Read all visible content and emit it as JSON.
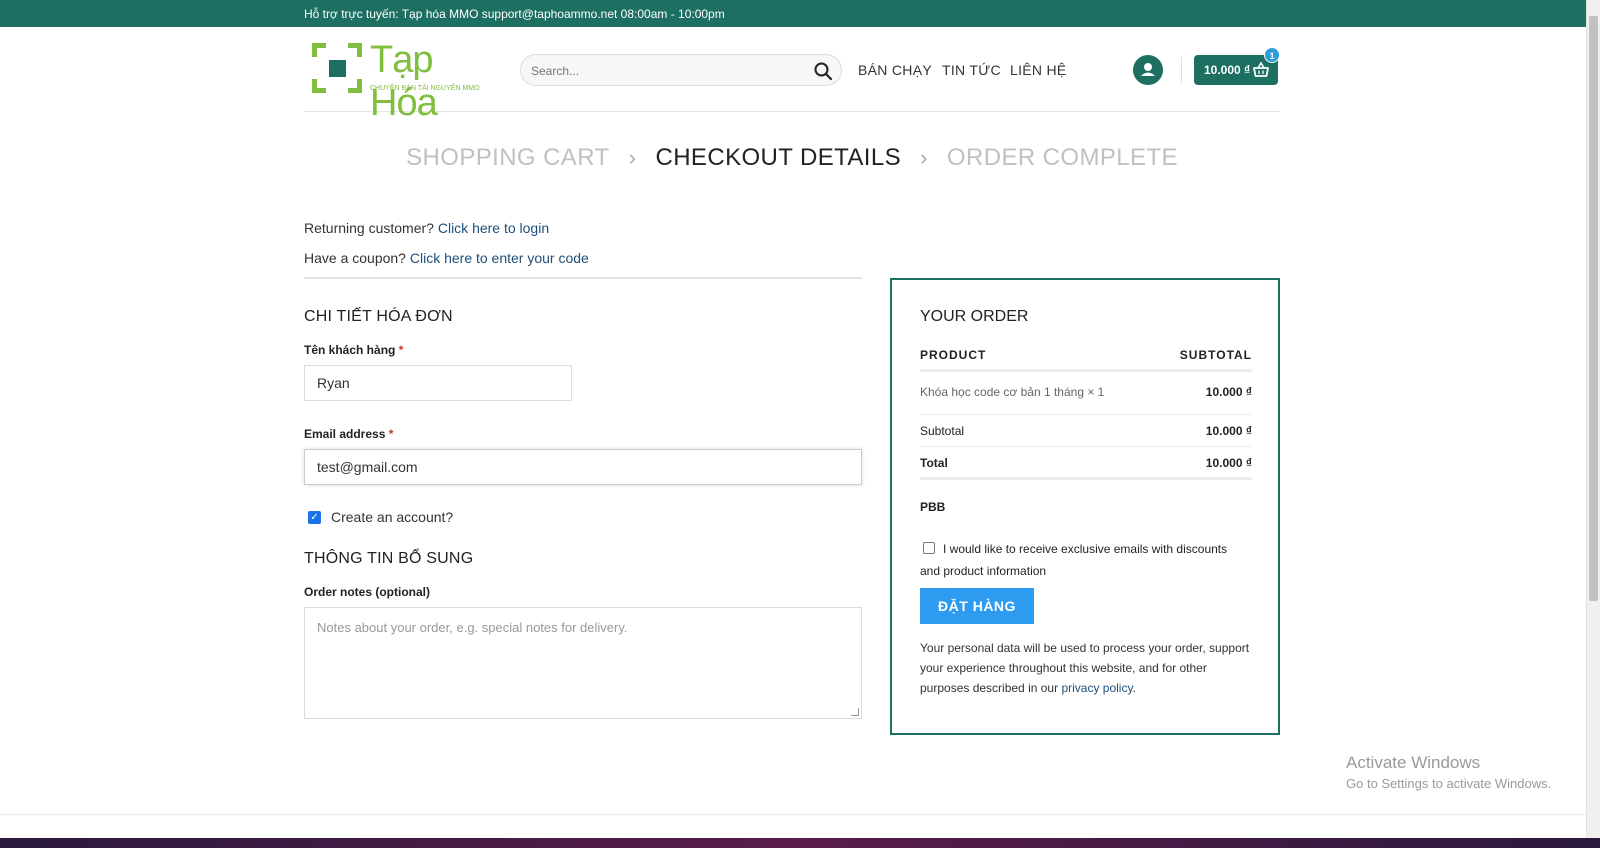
{
  "topbar": {
    "text": "Hỗ trợ trực tuyến: Tạp hóa MMO support@taphoammo.net 08:00am - 10:00pm"
  },
  "header": {
    "logo_name": "Tạp Hóa",
    "logo_tagline": "CHUYÊN BÁN TÀI NGUYÊN MMO",
    "search_placeholder": "Search...",
    "nav": [
      "BÁN CHẠY",
      "TIN TỨC",
      "LIÊN HỆ"
    ],
    "cart_amount": "10.000 ₫",
    "cart_count": "1"
  },
  "steps": {
    "cart": "SHOPPING CART",
    "checkout": "CHECKOUT DETAILS",
    "complete": "ORDER COMPLETE",
    "sep": "›"
  },
  "notices": {
    "returning_prefix": "Returning customer?",
    "returning_link": "Click here to login",
    "coupon_prefix": "Have a coupon?",
    "coupon_link": "Click here to enter your code"
  },
  "billing": {
    "title": "CHI TIẾT HÓA ĐƠN",
    "name_label": "Tên khách hàng",
    "name_value": "Ryan",
    "email_label": "Email address",
    "email_value": "test@gmail.com",
    "required_mark": "*",
    "create_account_label": "Create an account?",
    "create_account_checked": true
  },
  "additional": {
    "title": "THÔNG TIN BỔ SUNG",
    "notes_label": "Order notes (optional)",
    "notes_placeholder": "Notes about your order, e.g. special notes for delivery."
  },
  "order": {
    "title": "YOUR ORDER",
    "col_product": "PRODUCT",
    "col_subtotal": "SUBTOTAL",
    "item_name": "Khóa học code cơ bản 1 tháng",
    "item_qty": "× 1",
    "item_price": "10.000 ₫",
    "subtotal_label": "Subtotal",
    "subtotal_value": "10.000 ₫",
    "total_label": "Total",
    "total_value": "10.000 ₫",
    "payment_method": "PBB",
    "email_optin": "I would like to receive exclusive emails with discounts and product information",
    "place_order": "ĐẶT HÀNG",
    "privacy_text": "Your personal data will be used to process your order, support your experience throughout this website, and for other purposes described in our",
    "privacy_link": "privacy policy",
    "privacy_end": "."
  },
  "watermark": {
    "line1": "Activate Windows",
    "line2": "Go to Settings to activate Windows."
  },
  "colors": {
    "brand": "#1c6f61",
    "logo_green": "#7fbf3d",
    "button_blue": "#2d9cf0"
  }
}
